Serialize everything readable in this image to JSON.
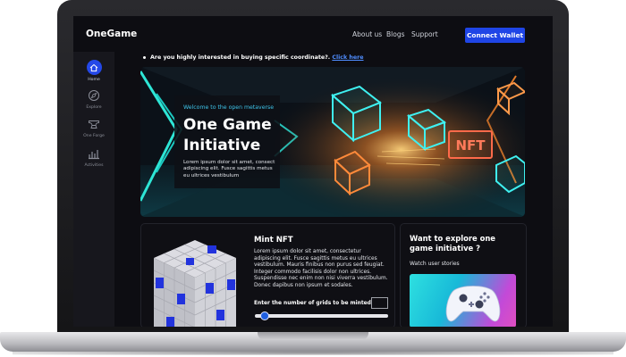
{
  "app": {
    "logo": "OneGame"
  },
  "nav": {
    "links": [
      "About us",
      "Blogs",
      "Support"
    ],
    "cta": "Connect Wallet"
  },
  "sidebar": {
    "items": [
      {
        "label": "Home",
        "icon": "home-icon"
      },
      {
        "label": "Explore",
        "icon": "compass-icon"
      },
      {
        "label": "One Forge",
        "icon": "anvil-icon"
      },
      {
        "label": "Activities",
        "icon": "bar-chart-icon"
      }
    ]
  },
  "announcement": {
    "text": "Are you highly interested in buying specific coordinate?.",
    "link": "Click here"
  },
  "hero": {
    "tag": "Welcome to the open metaverse",
    "title": "One Game Initiative",
    "description": "Lorem ipsum dolor sit amet, consect adipiscing elit. Fusce sagittis metus eu ultrices vestibulum",
    "sign_text": "NFT"
  },
  "mint": {
    "title": "Mint NFT",
    "description": "Lorem ipsum dolor sit amet, consectetur adipiscing elit. Fusce sagittis metus eu ultrices vestibulum. Mauris finibus non purus sed feugiat. Integer commodo facilisis dolor non ultrices. Suspendisse nec enim non nisi viverra vestibulum. Donec dapibus non ipsum et sodales.",
    "grid_label": "Enter the number of grids to be minted:",
    "grid_value": "",
    "slider_value": 0.04
  },
  "explore": {
    "title": "Want to explore one game initiative ?",
    "link": "Watch user stories"
  },
  "colors": {
    "accent": "#1f45e6",
    "link": "#4f8dff",
    "neon": "#3ec3e8"
  }
}
